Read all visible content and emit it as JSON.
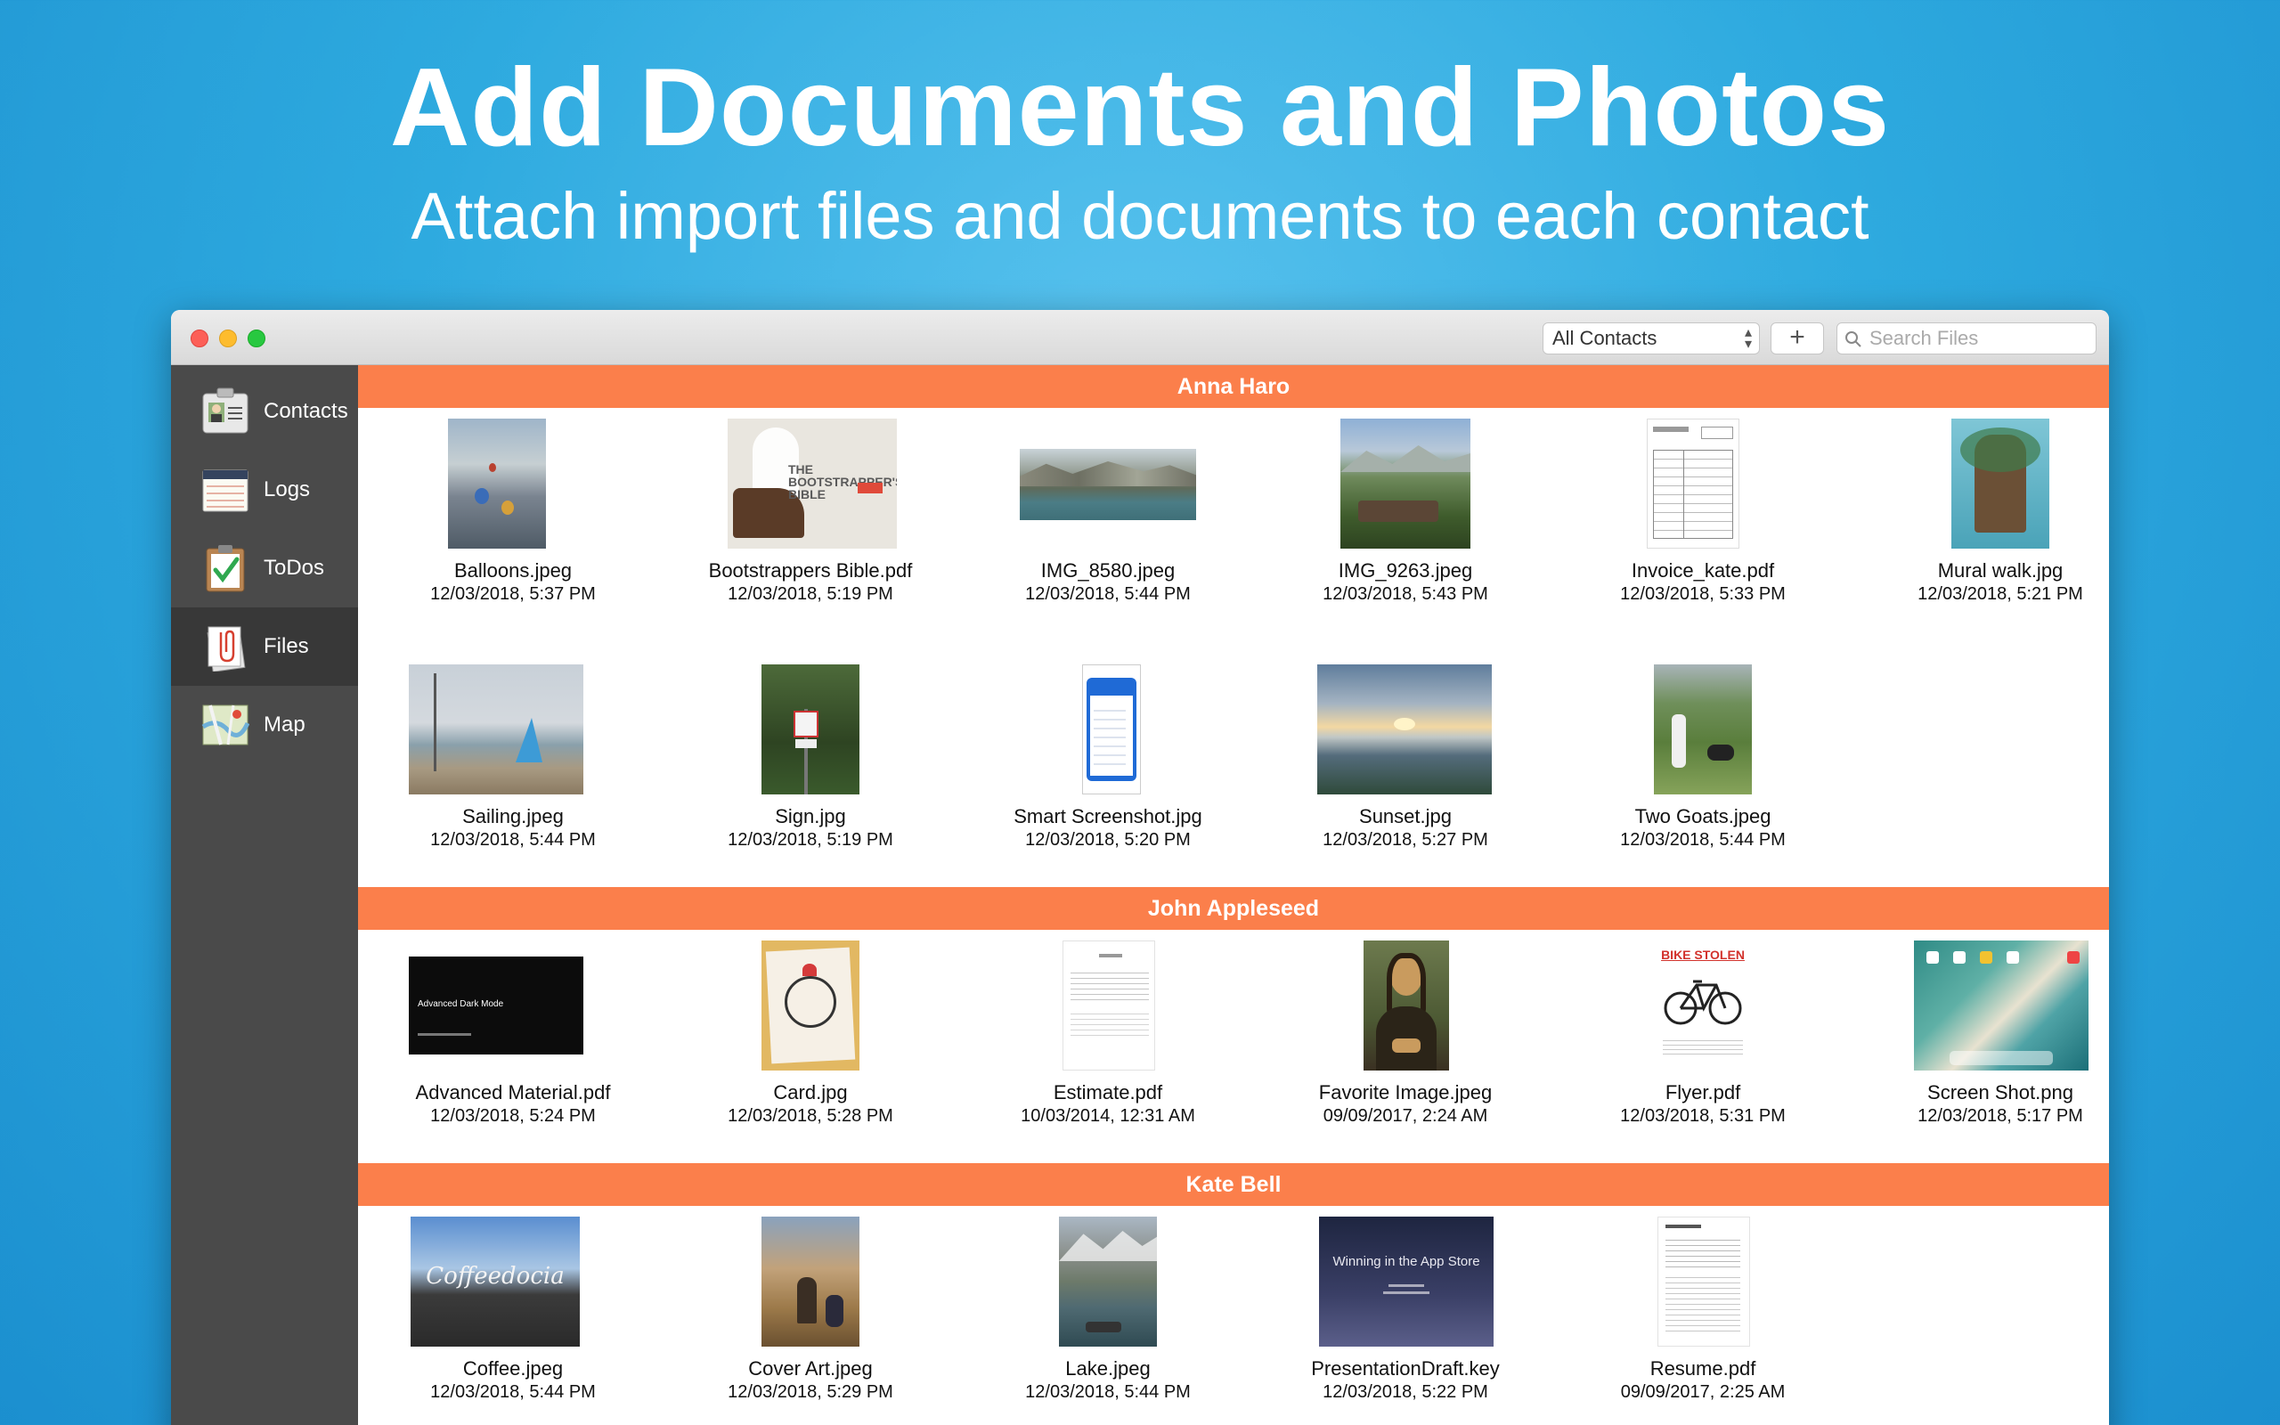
{
  "hero": {
    "title": "Add Documents and Photos",
    "subtitle": "Attach import files and documents to each contact"
  },
  "toolbar": {
    "contacts_filter": "All Contacts",
    "add_label": "+",
    "search_placeholder": "Search Files"
  },
  "sidebar": {
    "items": [
      {
        "label": "Contacts",
        "icon": "contacts-card-icon"
      },
      {
        "label": "Logs",
        "icon": "notepad-icon"
      },
      {
        "label": "ToDos",
        "icon": "clipboard-check-icon"
      },
      {
        "label": "Files",
        "icon": "paperclip-file-icon",
        "selected": true
      },
      {
        "label": "Map",
        "icon": "map-icon"
      }
    ]
  },
  "sections": [
    {
      "name": "Anna Haro",
      "files": [
        {
          "name": "Balloons.jpeg",
          "date": "12/03/2018, 5:37 PM"
        },
        {
          "name": "Bootstrappers Bible.pdf",
          "date": "12/03/2018, 5:19 PM"
        },
        {
          "name": "IMG_8580.jpeg",
          "date": "12/03/2018, 5:44 PM"
        },
        {
          "name": "IMG_9263.jpeg",
          "date": "12/03/2018, 5:43 PM"
        },
        {
          "name": "Invoice_kate.pdf",
          "date": "12/03/2018, 5:33 PM"
        },
        {
          "name": "Mural walk.jpg",
          "date": "12/03/2018, 5:21 PM"
        },
        {
          "name": "Sailing.jpeg",
          "date": "12/03/2018, 5:44 PM"
        },
        {
          "name": "Sign.jpg",
          "date": "12/03/2018, 5:19 PM"
        },
        {
          "name": "Smart Screenshot.jpg",
          "date": "12/03/2018, 5:20 PM"
        },
        {
          "name": "Sunset.jpg",
          "date": "12/03/2018, 5:27 PM"
        },
        {
          "name": "Two Goats.jpeg",
          "date": "12/03/2018, 5:44 PM"
        }
      ]
    },
    {
      "name": "John Appleseed",
      "files": [
        {
          "name": "Advanced Material.pdf",
          "date": "12/03/2018, 5:24 PM"
        },
        {
          "name": "Card.jpg",
          "date": "12/03/2018, 5:28 PM"
        },
        {
          "name": "Estimate.pdf",
          "date": "10/03/2014, 12:31 AM"
        },
        {
          "name": "Favorite Image.jpeg",
          "date": "09/09/2017, 2:24 AM"
        },
        {
          "name": "Flyer.pdf",
          "date": "12/03/2018, 5:31 PM"
        },
        {
          "name": "Screen Shot.png",
          "date": "12/03/2018, 5:17 PM"
        }
      ]
    },
    {
      "name": "Kate Bell",
      "files": [
        {
          "name": "Coffee.jpeg",
          "date": "12/03/2018, 5:44 PM"
        },
        {
          "name": "Cover Art.jpeg",
          "date": "12/03/2018, 5:29 PM"
        },
        {
          "name": "Lake.jpeg",
          "date": "12/03/2018, 5:44 PM"
        },
        {
          "name": "PresentationDraft.key",
          "date": "12/03/2018, 5:22 PM"
        },
        {
          "name": "Resume.pdf",
          "date": "09/09/2017, 2:25 AM"
        }
      ]
    }
  ],
  "thumbnail_text": {
    "bootstrapper_title": "THE BOOTSTRAPPER'S BIBLE",
    "advanced_dark_mode": "Advanced Dark Mode",
    "bike_stolen": "BIKE STOLEN",
    "coffee_sign": "Coffeedocia",
    "presentation_title": "Winning in the App Store"
  },
  "colors": {
    "section_bar": "#fb7f4b",
    "sidebar": "#4a4a4a",
    "sidebar_selected": "#383838",
    "background": "#2eaadf"
  }
}
